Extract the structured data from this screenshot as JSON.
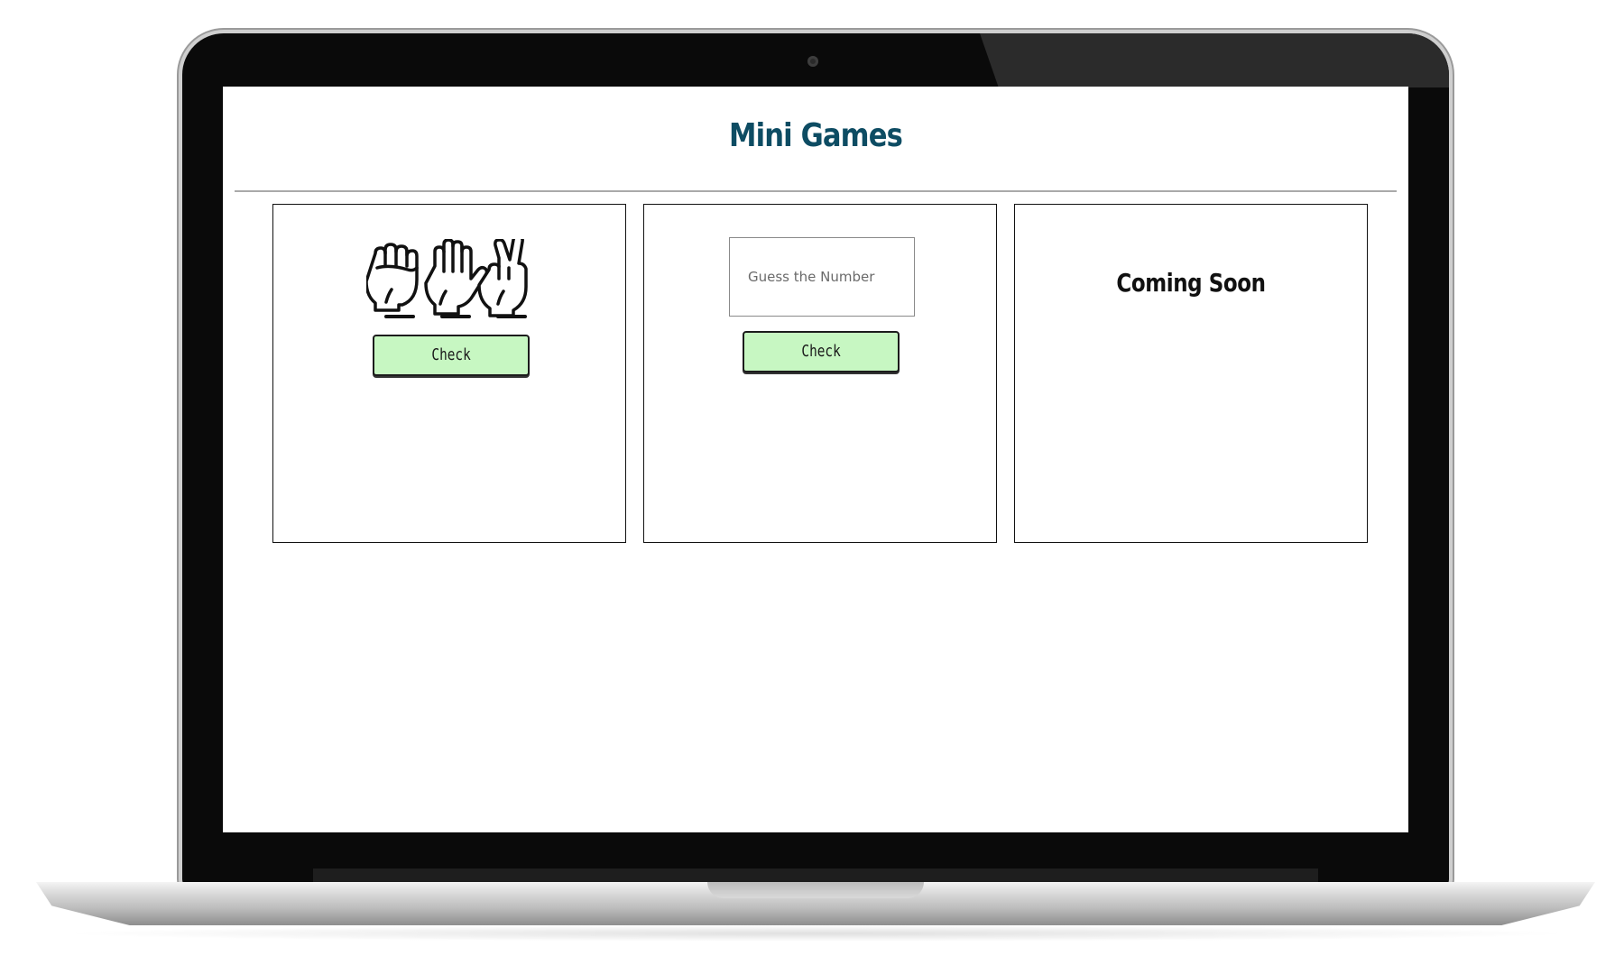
{
  "page": {
    "title": "Mini Games"
  },
  "games": {
    "rock_paper_scissors": {
      "icons": [
        "fist-icon",
        "open-palm-icon",
        "peace-sign-icon"
      ],
      "check_label": "Check"
    },
    "guess_number": {
      "input_placeholder": "Guess the Number",
      "input_value": "",
      "check_label": "Check"
    },
    "coming_soon": {
      "label": "Coming Soon"
    }
  },
  "colors": {
    "title": "#0d4c63",
    "button_bg": "#c7f7c2",
    "card_border": "#111111"
  }
}
